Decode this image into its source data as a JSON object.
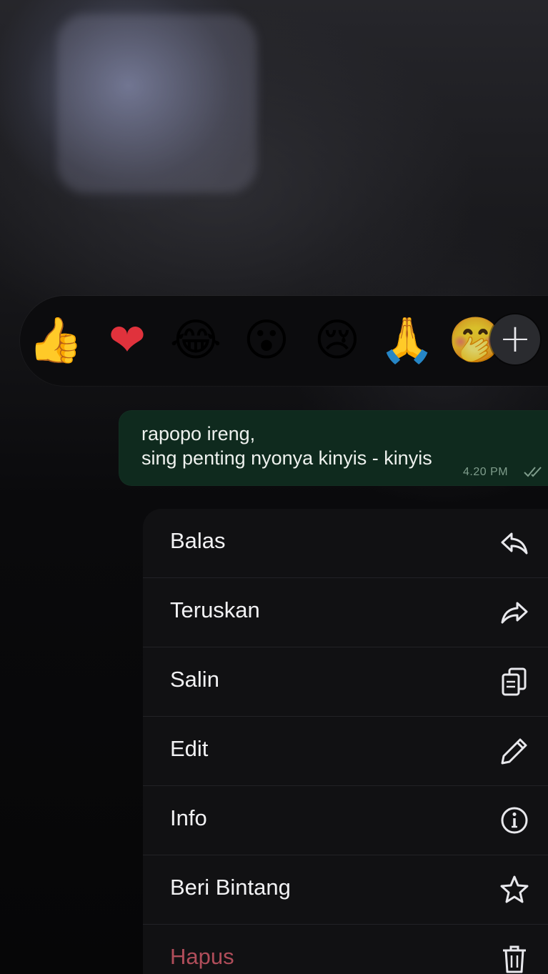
{
  "reactions": {
    "emojis": [
      {
        "name": "thumbs-up",
        "glyph": "👍"
      },
      {
        "name": "red-heart",
        "glyph": "❤"
      },
      {
        "name": "tears-of-joy",
        "glyph": "😂"
      },
      {
        "name": "surprised-face",
        "glyph": "😮"
      },
      {
        "name": "crying-face",
        "glyph": "😢"
      },
      {
        "name": "folded-hands",
        "glyph": "🙏"
      },
      {
        "name": "partially-hidden-emoji",
        "glyph": "🤭"
      }
    ],
    "more_label": "+"
  },
  "message": {
    "line1": "rapopo ireng,",
    "line2": "sing penting nyonya kinyis - kinyis",
    "time": "4.20 PM",
    "status_icon": "double-check-icon",
    "bubble_color": "#0f2a1e"
  },
  "menu": {
    "items": [
      {
        "label": "Balas",
        "icon": "reply-icon"
      },
      {
        "label": "Teruskan",
        "icon": "forward-icon"
      },
      {
        "label": "Salin",
        "icon": "copy-icon"
      },
      {
        "label": "Edit",
        "icon": "pencil-icon"
      },
      {
        "label": "Info",
        "icon": "info-icon"
      },
      {
        "label": "Beri Bintang",
        "icon": "star-icon"
      },
      {
        "label": "Hapus",
        "icon": "trash-icon",
        "danger": true
      }
    ],
    "danger_color": "#b04d5a"
  }
}
